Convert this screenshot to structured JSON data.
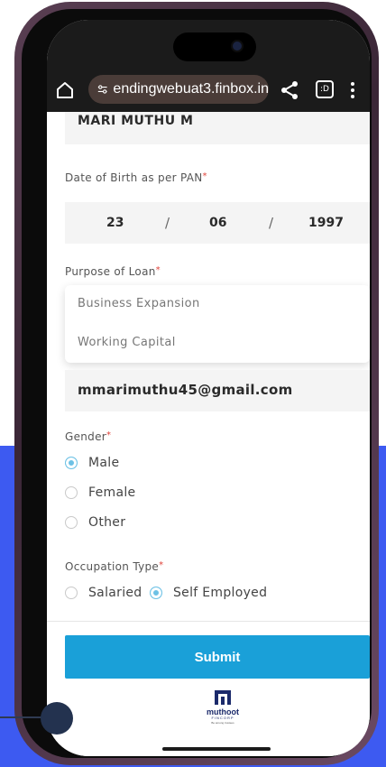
{
  "browser": {
    "url": "endingwebuat3.finbox.in",
    "tabs_count": ":D"
  },
  "form": {
    "name_value": "MARI MUTHU M",
    "dob_label": "Date of Birth as per PAN",
    "dob": {
      "day": "23",
      "month": "06",
      "year": "1997",
      "separator": "/"
    },
    "purpose_label": "Purpose of Loan",
    "purpose_options": [
      "Business Expansion",
      "Working Capital"
    ],
    "email_value": "mmarimuthu45@gmail.com",
    "gender_label": "Gender",
    "gender_options": [
      "Male",
      "Female",
      "Other"
    ],
    "gender_selected": "Male",
    "occupation_label": "Occupation Type",
    "occupation_options": [
      "Salaried",
      "Self Employed"
    ],
    "occupation_selected": "Self Employed",
    "required_marker": "*",
    "submit_label": "Submit"
  },
  "logo": {
    "brand": "muthoot",
    "sub": "FINCORP",
    "tagline": "Be among trustees"
  },
  "colors": {
    "accent": "#1aa0d8",
    "backdrop": "#3D5AF1",
    "required": "#e0433a"
  },
  "icons": [
    "home-icon",
    "site-settings-icon",
    "share-icon",
    "tabs-icon",
    "more-vert-icon"
  ]
}
